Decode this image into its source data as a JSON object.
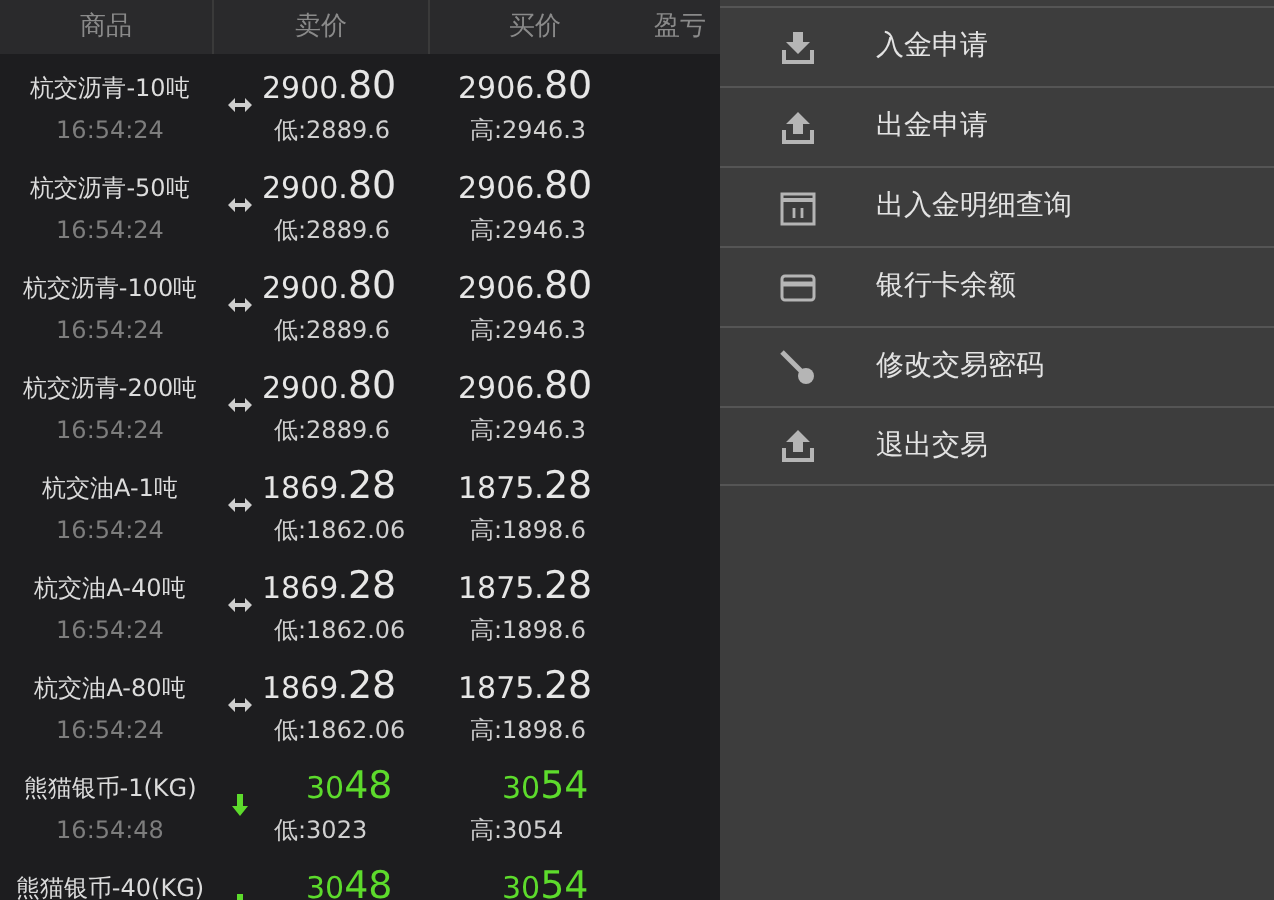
{
  "table": {
    "columns": [
      "商品",
      "卖价",
      "买价",
      "盈亏"
    ],
    "rows": [
      {
        "name": "杭交沥青-10吨",
        "time": "16:54:24",
        "kind": "flat",
        "sell_int": "2900.",
        "sell_dec": "80",
        "buy_int": "2906.",
        "buy_dec": "80",
        "low": "低:2889.6",
        "high": "高:2946.3"
      },
      {
        "name": "杭交沥青-50吨",
        "time": "16:54:24",
        "kind": "flat",
        "sell_int": "2900.",
        "sell_dec": "80",
        "buy_int": "2906.",
        "buy_dec": "80",
        "low": "低:2889.6",
        "high": "高:2946.3"
      },
      {
        "name": "杭交沥青-100吨",
        "time": "16:54:24",
        "kind": "flat",
        "sell_int": "2900.",
        "sell_dec": "80",
        "buy_int": "2906.",
        "buy_dec": "80",
        "low": "低:2889.6",
        "high": "高:2946.3"
      },
      {
        "name": "杭交沥青-200吨",
        "time": "16:54:24",
        "kind": "flat",
        "sell_int": "2900.",
        "sell_dec": "80",
        "buy_int": "2906.",
        "buy_dec": "80",
        "low": "低:2889.6",
        "high": "高:2946.3"
      },
      {
        "name": "杭交油A-1吨",
        "time": "16:54:24",
        "kind": "flat",
        "sell_int": "1869.",
        "sell_dec": "28",
        "buy_int": "1875.",
        "buy_dec": "28",
        "low": "低:1862.06",
        "high": "高:1898.6"
      },
      {
        "name": "杭交油A-40吨",
        "time": "16:54:24",
        "kind": "flat",
        "sell_int": "1869.",
        "sell_dec": "28",
        "buy_int": "1875.",
        "buy_dec": "28",
        "low": "低:1862.06",
        "high": "高:1898.6"
      },
      {
        "name": "杭交油A-80吨",
        "time": "16:54:24",
        "kind": "flat",
        "sell_int": "1869.",
        "sell_dec": "28",
        "buy_int": "1875.",
        "buy_dec": "28",
        "low": "低:1862.06",
        "high": "高:1898.6"
      },
      {
        "name": "熊猫银币-1(KG)",
        "time": "16:54:48",
        "kind": "down",
        "sell_int": "30",
        "sell_dec": "48",
        "buy_int": "30",
        "buy_dec": "54",
        "low": "低:3023",
        "high": "高:3054"
      },
      {
        "name": "熊猫银币-40(KG)",
        "kind": "down",
        "sell_int": "30",
        "sell_dec": "48",
        "buy_int": "30",
        "buy_dec": "54"
      }
    ]
  },
  "menu": [
    {
      "kind": "deposit",
      "label": "入金申请"
    },
    {
      "kind": "withdraw",
      "label": "出金申请"
    },
    {
      "kind": "calendar",
      "label": "出入金明细查询"
    },
    {
      "kind": "card",
      "label": "银行卡余额"
    },
    {
      "kind": "key",
      "label": "修改交易密码"
    },
    {
      "kind": "withdraw",
      "label": "退出交易"
    }
  ]
}
